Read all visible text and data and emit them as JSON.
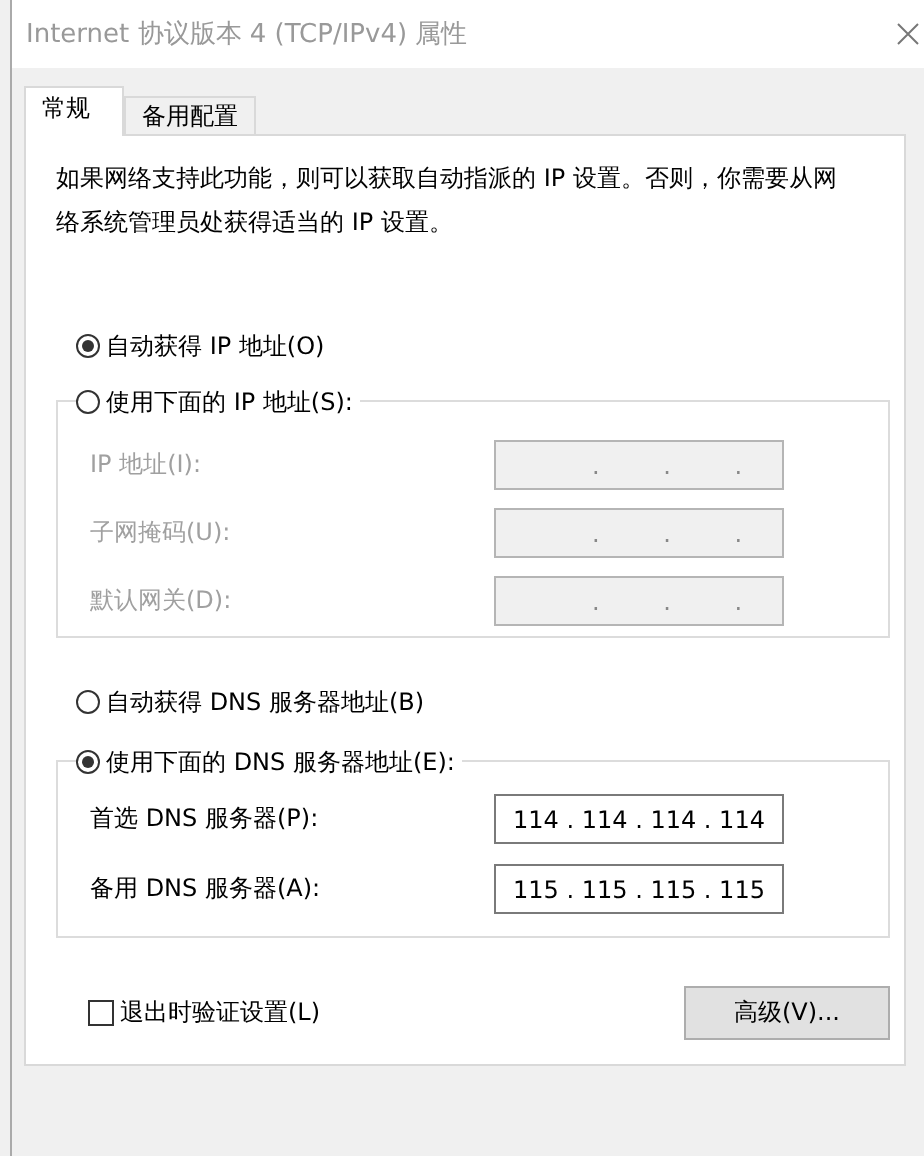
{
  "window": {
    "title": "Internet 协议版本 4 (TCP/IPv4) 属性"
  },
  "tabs": [
    {
      "label": "常规",
      "selected": true
    },
    {
      "label": "备用配置",
      "selected": false
    }
  ],
  "description": "如果网络支持此功能，则可以获取自动指派的 IP 设置。否则，你需要从网络系统管理员处获得适当的 IP 设置。",
  "ip_options": [
    {
      "label": "自动获得 IP 地址(O)",
      "selected": true
    },
    {
      "label": "使用下面的 IP 地址(S):",
      "selected": false
    }
  ],
  "ip_fields": [
    {
      "label": "IP 地址(I):",
      "value": ". . .",
      "disabled": true
    },
    {
      "label": "子网掩码(U):",
      "value": ". . .",
      "disabled": true
    },
    {
      "label": "默认网关(D):",
      "value": ". . .",
      "disabled": true
    }
  ],
  "dns_options": [
    {
      "label": "自动获得 DNS 服务器地址(B)",
      "selected": false
    },
    {
      "label": "使用下面的 DNS 服务器地址(E):",
      "selected": true
    }
  ],
  "dns_fields": [
    {
      "label": "首选 DNS 服务器(P):",
      "value": "114 . 114 . 114 . 114",
      "disabled": false
    },
    {
      "label": "备用 DNS 服务器(A):",
      "value": "115 . 115 . 115 . 115",
      "disabled": false
    }
  ],
  "validate_on_exit": {
    "label": "退出时验证设置(L)",
    "checked": false
  },
  "buttons": [
    {
      "label": "高级(V)..."
    }
  ]
}
